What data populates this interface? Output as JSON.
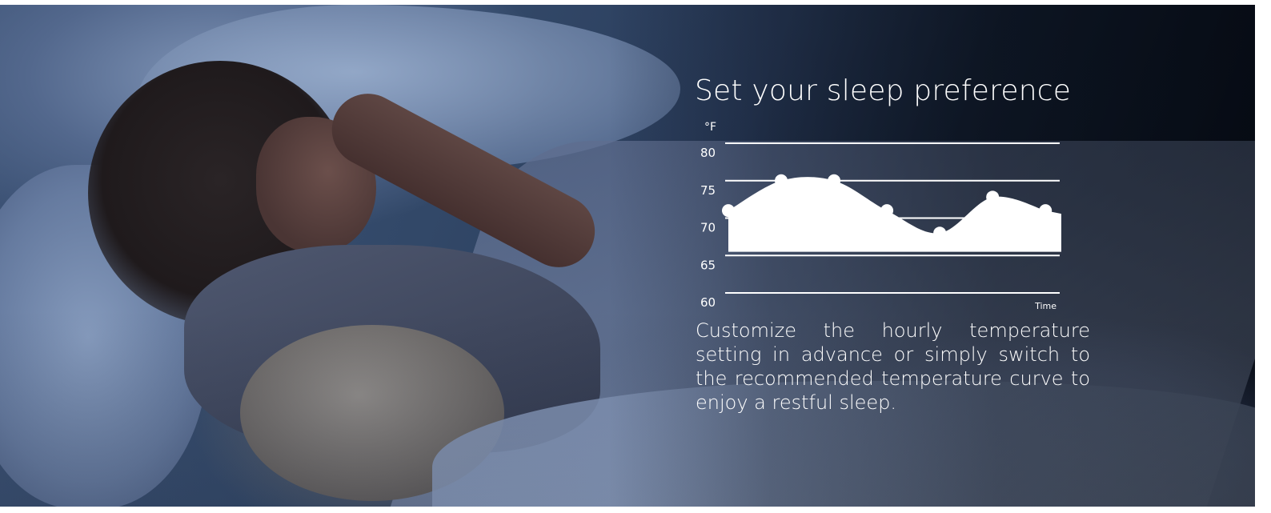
{
  "hero": {
    "photo": "child-sleeping-with-teddy-bear"
  },
  "title": "Set your sleep preference",
  "description": "Customize the hourly temperature setting in advance or simply switch to the recommended temperature curve to enjoy a restful sleep.",
  "chart_data": {
    "type": "area",
    "title": "",
    "ylabel": "°F",
    "xlabel": "Time",
    "ylim": [
      60,
      80
    ],
    "yticks": [
      "80",
      "75",
      "70",
      "65",
      "60"
    ],
    "ytick_values": [
      80,
      75,
      70,
      65,
      60
    ],
    "grid": true,
    "series": [
      {
        "x": [
          0,
          1,
          2,
          3,
          4,
          5,
          6
        ],
        "values": [
          71.0,
          75.0,
          75.0,
          71.0,
          68.0,
          72.8,
          71.0
        ],
        "color": "#ffffff"
      }
    ],
    "curve_xlim": [
      0,
      6.3
    ]
  }
}
